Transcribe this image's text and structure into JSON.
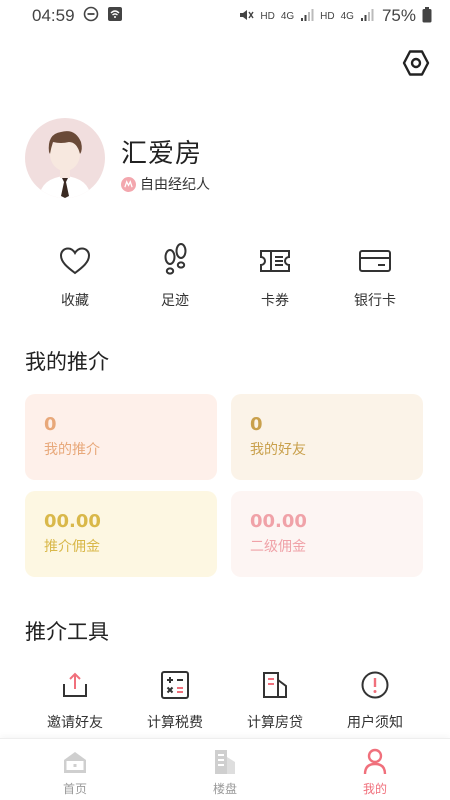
{
  "status_bar": {
    "time": "04:59",
    "hd1": "HD",
    "net1": "4G",
    "hd2": "HD",
    "net2": "4G",
    "battery": "75%"
  },
  "colors": {
    "accent": "#f0707c",
    "orange": "#e8a87a",
    "gold": "#d9b84a",
    "gold_text": "#c9a04c",
    "pink": "#f0a2a8"
  },
  "profile": {
    "name": "汇爱房",
    "role": "自由经纪人",
    "settings_icon": "settings-icon"
  },
  "quick_actions": [
    {
      "label": "收藏",
      "icon": "heart-icon"
    },
    {
      "label": "足迹",
      "icon": "footprints-icon"
    },
    {
      "label": "卡券",
      "icon": "ticket-icon"
    },
    {
      "label": "银行卡",
      "icon": "bank-card-icon"
    }
  ],
  "referral": {
    "title": "我的推介",
    "cards": [
      {
        "value": "0",
        "label": "我的推介"
      },
      {
        "value": "0",
        "label": "我的好友"
      },
      {
        "value": "00.00",
        "label": "推介佣金"
      },
      {
        "value": "00.00",
        "label": "二级佣金"
      }
    ]
  },
  "tools": {
    "title": "推介工具",
    "items": [
      {
        "label": "邀请好友",
        "icon": "share-icon"
      },
      {
        "label": "计算税费",
        "icon": "calculator-icon"
      },
      {
        "label": "计算房贷",
        "icon": "building-icon"
      },
      {
        "label": "用户须知",
        "icon": "info-icon"
      }
    ]
  },
  "bottom_nav": [
    {
      "label": "首页",
      "icon": "home-icon",
      "active": false
    },
    {
      "label": "楼盘",
      "icon": "buildings-icon",
      "active": false
    },
    {
      "label": "我的",
      "icon": "profile-icon",
      "active": true
    }
  ]
}
